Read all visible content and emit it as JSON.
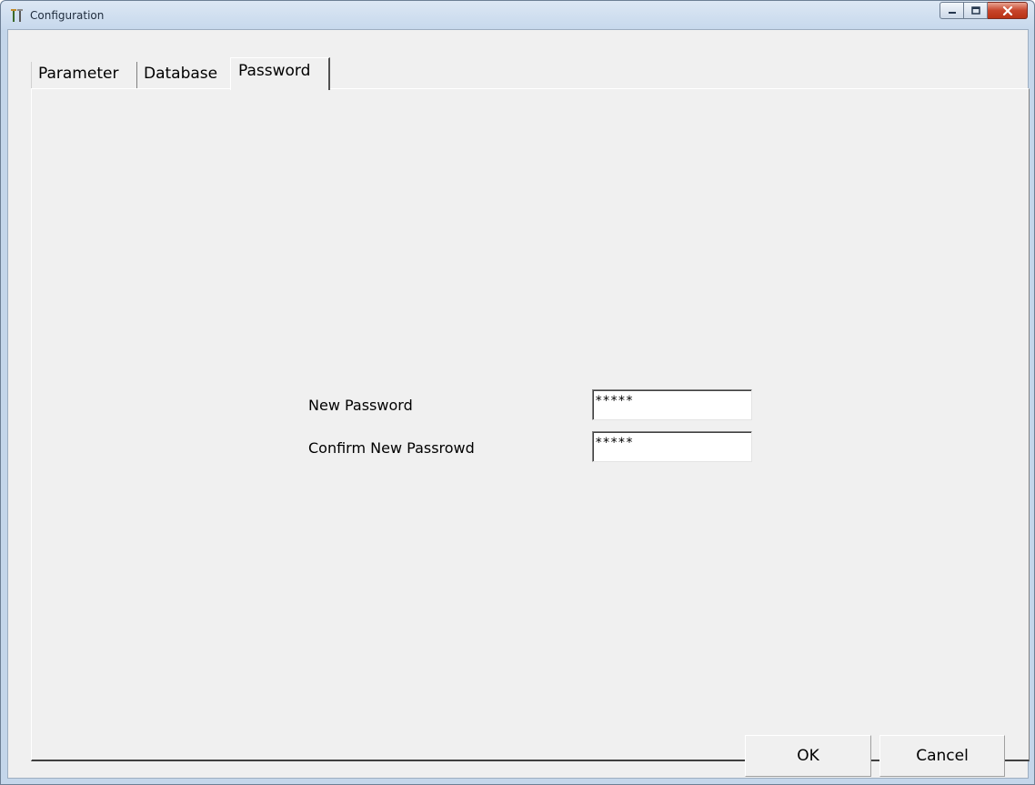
{
  "window": {
    "title": "Configuration",
    "icon": "tools-icon",
    "caption_buttons": [
      "minimize-icon",
      "maximize-icon",
      "close-icon"
    ]
  },
  "tabs": [
    {
      "label": "Parameter",
      "selected": false
    },
    {
      "label": "Database",
      "selected": false
    },
    {
      "label": "Password",
      "selected": true
    }
  ],
  "password_panel": {
    "new_password_label": "New Password",
    "new_password_value": "*****",
    "confirm_password_label": "Confirm New Passrowd",
    "confirm_password_value": "*****"
  },
  "buttons": {
    "ok_label": "OK",
    "cancel_label": "Cancel"
  },
  "colors": {
    "titlebar": "#c6d8ec",
    "close_button": "#c7442b",
    "dialog_background": "#f0f0f0"
  }
}
